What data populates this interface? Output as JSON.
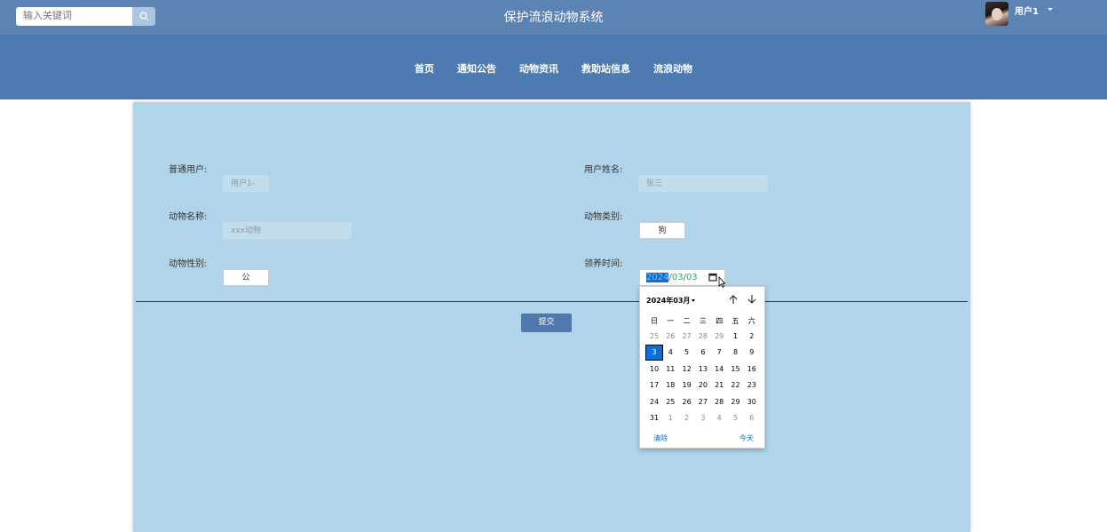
{
  "header": {
    "search_placeholder": "输入关键词",
    "site_title": "保护流浪动物系统",
    "user_name": "用户1"
  },
  "nav": {
    "items": [
      "首页",
      "通知公告",
      "动物资讯",
      "救助站信息",
      "流浪动物"
    ]
  },
  "form": {
    "user_label": "普通用户:",
    "user_value": "用户1-",
    "user_name_label": "用户姓名:",
    "user_name_value": "张三",
    "animal_name_label": "动物名称:",
    "animal_name_value": "xxx动物",
    "animal_type_label": "动物类别:",
    "animal_type_value": "狗",
    "animal_sex_label": "动物性别:",
    "animal_sex_value": "公",
    "adopt_time_label": "领养时间:",
    "adopt_date": {
      "year": "2024",
      "month": "03",
      "day": "03",
      "sep": "/"
    },
    "submit_label": "提交"
  },
  "calendar": {
    "month_label": "2024年03月",
    "weekdays": [
      "日",
      "一",
      "二",
      "三",
      "四",
      "五",
      "六"
    ],
    "weeks": [
      [
        "25",
        "26",
        "27",
        "28",
        "29",
        "1",
        "2"
      ],
      [
        "3",
        "4",
        "5",
        "6",
        "7",
        "8",
        "9"
      ],
      [
        "10",
        "11",
        "12",
        "13",
        "14",
        "15",
        "16"
      ],
      [
        "17",
        "18",
        "19",
        "20",
        "21",
        "22",
        "23"
      ],
      [
        "24",
        "25",
        "26",
        "27",
        "28",
        "29",
        "30"
      ],
      [
        "31",
        "1",
        "2",
        "3",
        "4",
        "5",
        "6"
      ]
    ],
    "selected_day": "3",
    "clear_label": "清除",
    "today_label": "今天"
  },
  "colors": {
    "topbar": "#5b84b4",
    "navbar": "#4d7ab0",
    "panel": "#b0d4ea",
    "accent": "#0a6fd8"
  }
}
